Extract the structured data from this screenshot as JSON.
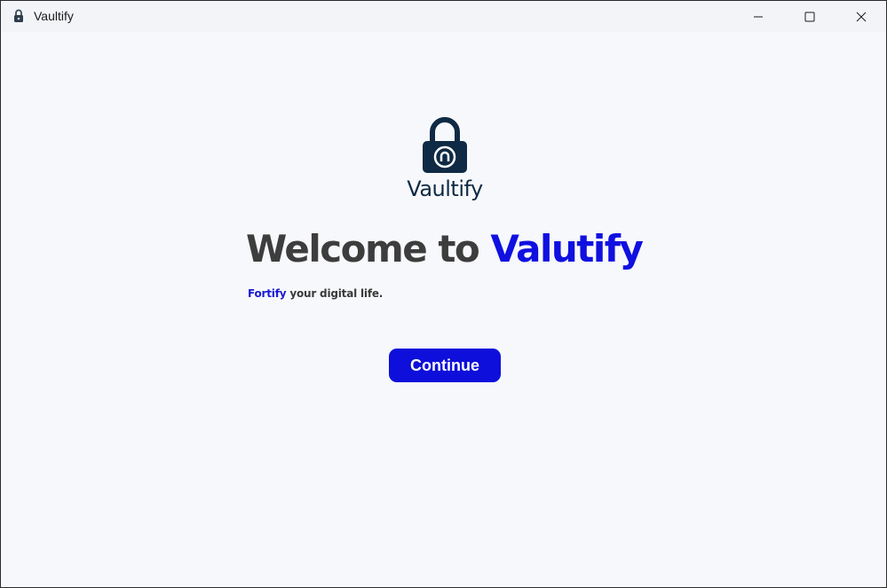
{
  "window": {
    "title": "Vaultify",
    "app_icon": "lock-icon",
    "controls": {
      "minimize": "minimize-icon",
      "maximize": "maximize-icon",
      "close": "close-icon"
    }
  },
  "brand": {
    "logo_icon": "padlock-icon",
    "name": "Vaultify",
    "logo_color": "#0f2a44"
  },
  "welcome": {
    "prefix": "Welcome to ",
    "highlight": "Valutify",
    "prefix_color": "#3d3d3d",
    "highlight_color": "#1010e0"
  },
  "tagline": {
    "highlight": "Fortify",
    "rest": " your digital life."
  },
  "actions": {
    "continue_label": "Continue",
    "button_color": "#0f0fdb"
  }
}
